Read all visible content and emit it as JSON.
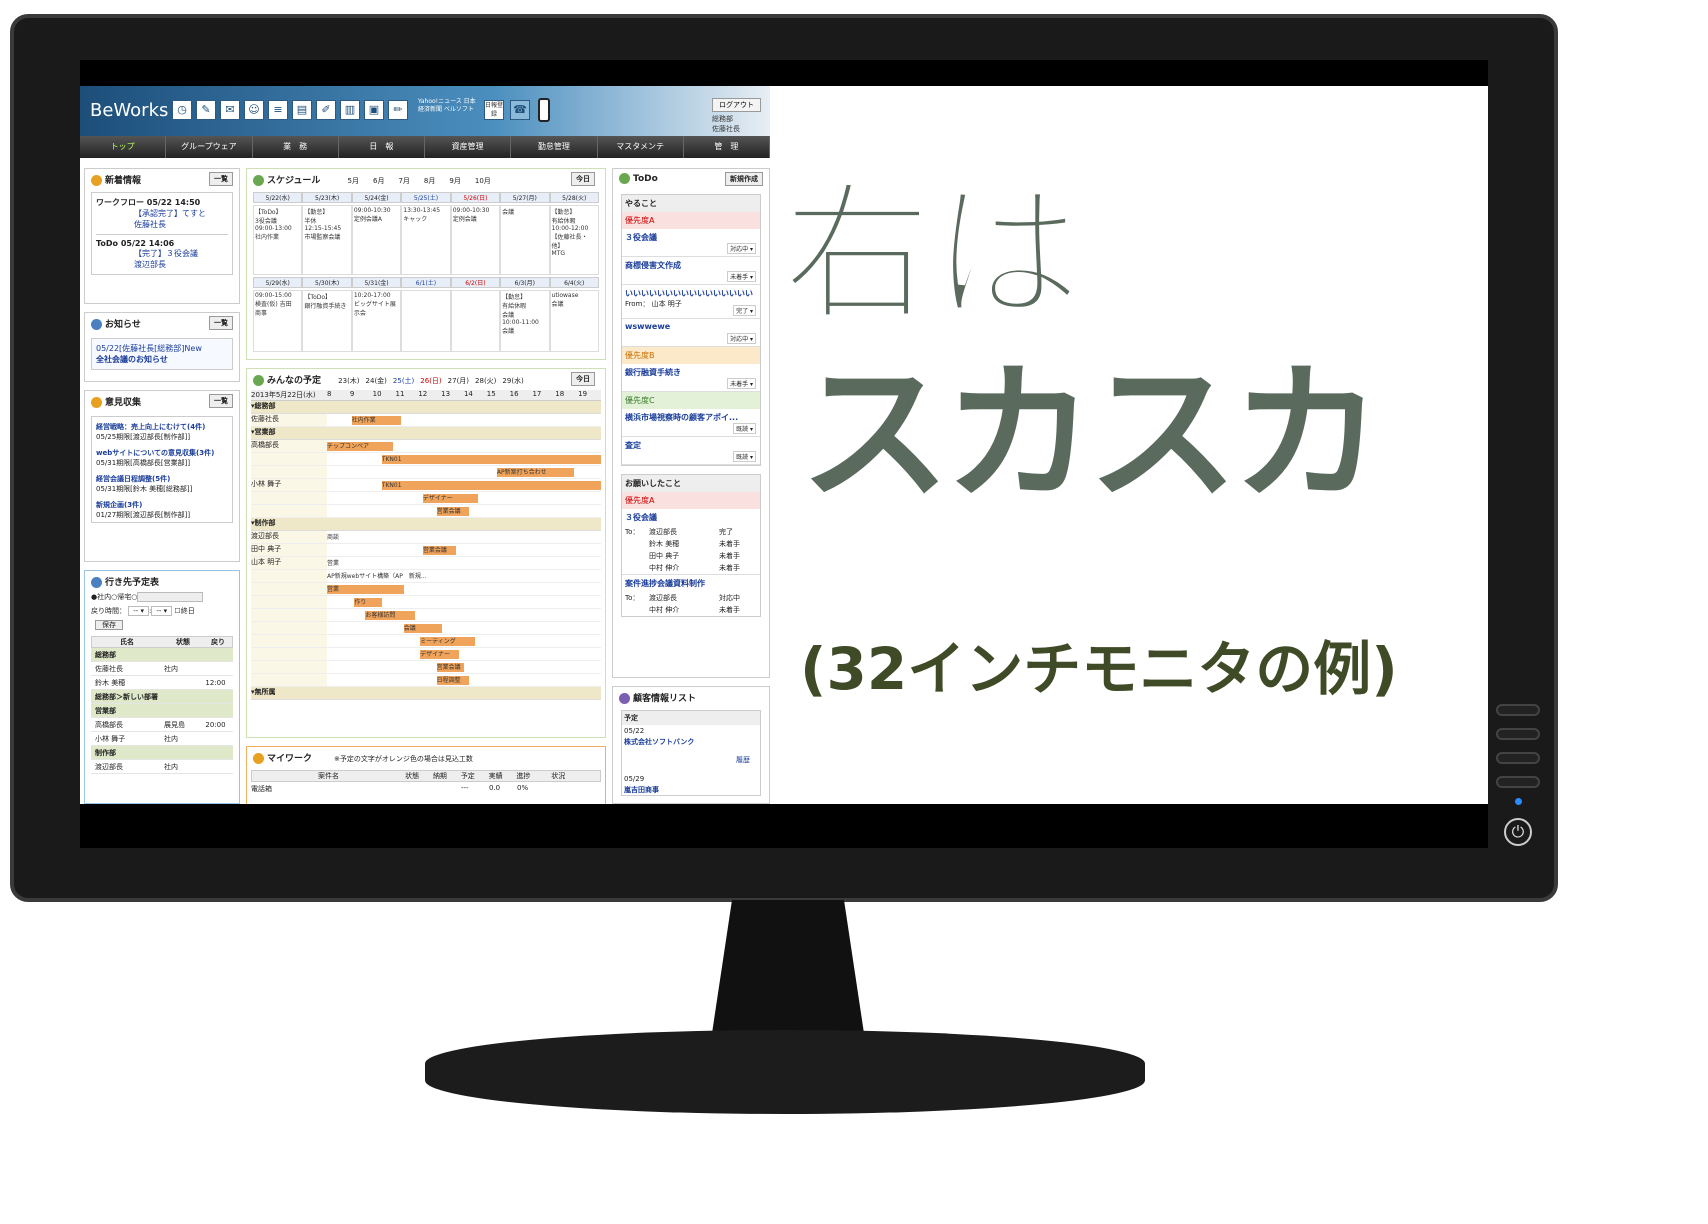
{
  "app": {
    "logo": "BeWorks",
    "logout": "ログアウト",
    "dept": "総務部",
    "user": "佐藤社長",
    "news_link": "Yahoo!ニュース 日本経済新聞 ベルソフト",
    "register_label": "日報登録"
  },
  "nav": [
    "トップ",
    "グループウェア",
    "業　務",
    "日　報",
    "資産管理",
    "勤怠管理",
    "マスタメンテ",
    "管　理"
  ],
  "news": {
    "title": "新着情報",
    "list_btn": "一覧",
    "items": [
      {
        "head": "ワークフロー 05/22 14:50",
        "line1": "【承認完了】てすと",
        "line2": "佐藤社長"
      },
      {
        "head": "ToDo 05/22 14:06",
        "line1": "【完了】３役会議",
        "line2": "渡辺部長"
      }
    ]
  },
  "notice": {
    "title": "お知らせ",
    "list_btn": "一覧",
    "text": "05/22[佐藤社長[総務部]New",
    "link": "全社会議のお知らせ"
  },
  "opinion": {
    "title": "意見収集",
    "list_btn": "一覧",
    "items": [
      {
        "t": "経営戦略：売上向上にむけて(4件)",
        "d": "05/25期限[渡辺部長[制作部]]"
      },
      {
        "t": "webサイトについての意見収集(3件)",
        "d": "05/31期限[高橋部長[営業部]]"
      },
      {
        "t": "経営会議日程調整(5件)",
        "d": "05/31期限[鈴木 美穂[総務部]]"
      },
      {
        "t": "新規企画(3件)",
        "d": "01/27期限[渡辺部長[制作部]]"
      }
    ]
  },
  "whereabouts": {
    "title": "行き先予定表",
    "radio": "●社内○帰宅○",
    "return_label": "戻り時間：",
    "end_label": "終日",
    "save": "保存",
    "cols": [
      "氏名",
      "状態",
      "戻り"
    ],
    "rows": [
      {
        "g": "総務部"
      },
      {
        "n": "佐藤社長",
        "s": "社内",
        "r": ""
      },
      {
        "n": "鈴木 美穂",
        "s": "",
        "r": "12:00"
      },
      {
        "g": "総務部＞新しい部署"
      },
      {
        "g": "営業部"
      },
      {
        "n": "高橋部長",
        "s": "展見島",
        "r": "20:00"
      },
      {
        "n": "小林 舞子",
        "s": "社内",
        "r": ""
      },
      {
        "g": "制作部"
      },
      {
        "n": "渡辺部長",
        "s": "社内",
        "r": ""
      }
    ]
  },
  "schedule": {
    "title": "スケジュール",
    "months": [
      "5月",
      "6月",
      "7月",
      "8月",
      "9月",
      "10月"
    ],
    "today": "今日",
    "week1": [
      "5/22(水)",
      "5/23(木)",
      "5/24(金)",
      "5/25(土)",
      "5/26(日)",
      "5/27(月)",
      "5/28(火)"
    ],
    "week2": [
      "5/29(水)",
      "5/30(木)",
      "5/31(金)",
      "6/1(土)",
      "6/2(日)",
      "6/3(月)",
      "6/4(火)"
    ],
    "w1cells": [
      "【ToDo】\n3役会議\n09:00-13:00\n社内作業",
      "【勤怠】\n半休\n12:15-15:45\n市場監察会議",
      "09:00-10:30\n定例会議A\n",
      "13:30-13:45\nキャック",
      "09:00-10:30\n定例会議",
      "会議",
      "【勤怠】\n有給休暇\n10:00-12:00\n【佐藤社長・他】\nMTG"
    ],
    "w2cells": [
      "09:00-15:00\n検査(仮) 吉田\n商事",
      "【ToDo】\n銀行融資手続き\n",
      "10:20-17:00\nビッグサイト展示会",
      "",
      "",
      "【勤怠】\n有給休暇\n会議\n10:00-11:00\n会議",
      "utiowase\n会議"
    ]
  },
  "everyone": {
    "title": "みんなの予定",
    "days": [
      "23(木)",
      "24(金)",
      "25(土)",
      "26(日)",
      "27(月)",
      "28(火)",
      "29(水)"
    ],
    "today": "今日",
    "date": "2013年5月22日(水)",
    "hours": [
      "8",
      "9",
      "10",
      "11",
      "12",
      "13",
      "14",
      "15",
      "16",
      "17",
      "18",
      "19"
    ],
    "rows": [
      {
        "g": "総務部"
      },
      {
        "n": "佐藤社長"
      },
      {
        "g": "営業部"
      },
      {
        "n": "高橋部長"
      },
      {
        "n": ""
      },
      {
        "n": ""
      },
      {
        "n": "小林 舞子"
      },
      {
        "n": ""
      },
      {
        "n": ""
      },
      {
        "g": "制作部"
      },
      {
        "n": "渡辺部長"
      },
      {
        "n": "田中 典子"
      },
      {
        "n": "山本 明子"
      },
      {
        "n": ""
      },
      {
        "n": ""
      },
      {
        "n": ""
      },
      {
        "n": ""
      },
      {
        "n": ""
      },
      {
        "n": ""
      },
      {
        "n": ""
      },
      {
        "n": ""
      },
      {
        "n": ""
      },
      {
        "g": "無所属"
      }
    ],
    "labels": [
      "社内作業",
      "チップコンペア",
      "TKN01",
      "AP新案打ち合わせ",
      "TKN01",
      "デザイナー",
      "営業会議",
      "商談",
      "営業会議",
      "営業",
      "AP新規webサイト構築（AP　新規...",
      "営業",
      "作り",
      "お客様訪問",
      "会議",
      "ミーティング",
      "デザイナー",
      "営業会議",
      "日程調整"
    ]
  },
  "mywork": {
    "title": "マイワーク",
    "note": "※予定の文字がオレンジ色の場合は見込工数",
    "cols": [
      "案件名",
      "状態",
      "納期",
      "予定",
      "実績",
      "進捗",
      "状況"
    ],
    "row": [
      "電話箱",
      "",
      "",
      "---",
      "0.0",
      "0%",
      ""
    ]
  },
  "todo": {
    "title": "ToDo",
    "new_btn": "新規作成",
    "todo_head": "やること",
    "items": [
      {
        "p": "優先度A"
      },
      {
        "t": "３役会議",
        "s": "対応中"
      },
      {
        "t": "商標侵害文作成",
        "s": "未着手"
      },
      {
        "t": "いいいいいいいいいいいいいいいい",
        "from": "From：  山本 明子",
        "s": "完了"
      },
      {
        "t": "wswwewe",
        "s": "対応中"
      },
      {
        "p": "優先度B"
      },
      {
        "t": "銀行融資手続き",
        "s": "未着手"
      },
      {
        "p": "優先度C"
      },
      {
        "t": "横浜市場視察時の顧客アポイ...",
        "s": "既読"
      },
      {
        "t": "査定",
        "s": "既読"
      }
    ],
    "req_head": "お願いしたこと",
    "req_prio": "優先度A",
    "req1": "３役会議",
    "req1_to": [
      [
        "To：",
        "渡辺部長",
        "完了"
      ],
      [
        "",
        "鈴木 美穂",
        "未着手"
      ],
      [
        "",
        "田中 典子",
        "未着手"
      ],
      [
        "",
        "中村 伸介",
        "未着手"
      ]
    ],
    "req2": "案件進捗会議資料制作",
    "req2_to": [
      [
        "To：",
        "渡辺部長",
        "対応中"
      ],
      [
        "",
        "中村 伸介",
        "未着手"
      ]
    ]
  },
  "customer": {
    "title": "顧客情報リスト",
    "sub": "予定",
    "items": [
      {
        "d": "05/22",
        "c": "株式会社ソフトバンク",
        "link": "履歴"
      },
      {
        "d": "05/29",
        "c": "嵐吉田商事"
      }
    ]
  },
  "overlay": {
    "line1": "右は",
    "line2": "スカスカ",
    "line3": "(32インチモニタの例)"
  }
}
